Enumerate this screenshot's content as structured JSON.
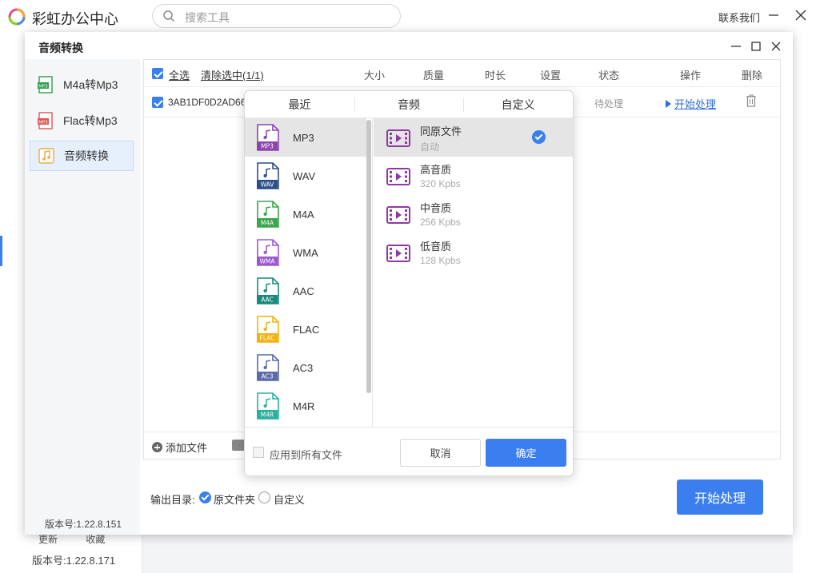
{
  "app": {
    "title": "彩虹办公中心",
    "search_placeholder": "搜索工具",
    "contact": "联系我们",
    "footer_links": [
      "更新",
      "收藏"
    ],
    "version": "版本号:1.22.8.171"
  },
  "dialog": {
    "title": "音频转换",
    "version": "版本号:1.22.8.151",
    "sidebar": [
      {
        "label": "M4a转Mp3",
        "icon": "m4a-to-mp3-icon"
      },
      {
        "label": "Flac转Mp3",
        "icon": "flac-to-mp3-icon"
      },
      {
        "label": "音频转换",
        "icon": "audio-convert-icon",
        "active": true
      }
    ],
    "file_list": {
      "select_all": "全选",
      "clear_selected": "清除选中(1/1)",
      "columns": [
        "大小",
        "质量",
        "时长",
        "设置",
        "状态",
        "操作",
        "删除"
      ],
      "rows": [
        {
          "filename": "3AB1DF0D2AD66",
          "status": "待处理",
          "action": "开始处理"
        }
      ],
      "add_file": "添加文件"
    },
    "output": {
      "label": "输出目录:",
      "options": [
        "原文件夹",
        "自定义"
      ],
      "selected": "原文件夹"
    },
    "start_button": "开始处理"
  },
  "format_popup": {
    "tabs": [
      "最近",
      "音频",
      "自定义"
    ],
    "formats": [
      {
        "label": "MP3",
        "color": "#8e44ad"
      },
      {
        "label": "WAV",
        "color": "#2c4f8a"
      },
      {
        "label": "M4A",
        "color": "#3aa54a"
      },
      {
        "label": "WMA",
        "color": "#9b59d0"
      },
      {
        "label": "AAC",
        "color": "#1a8a7c"
      },
      {
        "label": "FLAC",
        "color": "#f2b311"
      },
      {
        "label": "AC3",
        "color": "#5b6aa8"
      },
      {
        "label": "M4R",
        "color": "#2ab0a0"
      }
    ],
    "selected_format": "MP3",
    "qualities": [
      {
        "name": "同原文件",
        "sub": "自动",
        "selected": true
      },
      {
        "name": "高音质",
        "sub": "320 Kpbs"
      },
      {
        "name": "中音质",
        "sub": "256 Kpbs"
      },
      {
        "name": "低音质",
        "sub": "128 Kpbs"
      }
    ],
    "apply_all": "应用到所有文件",
    "cancel": "取消",
    "confirm": "确定"
  },
  "colors": {
    "accent": "#3b7ef0",
    "quality_icon": "#8e3aa0"
  }
}
